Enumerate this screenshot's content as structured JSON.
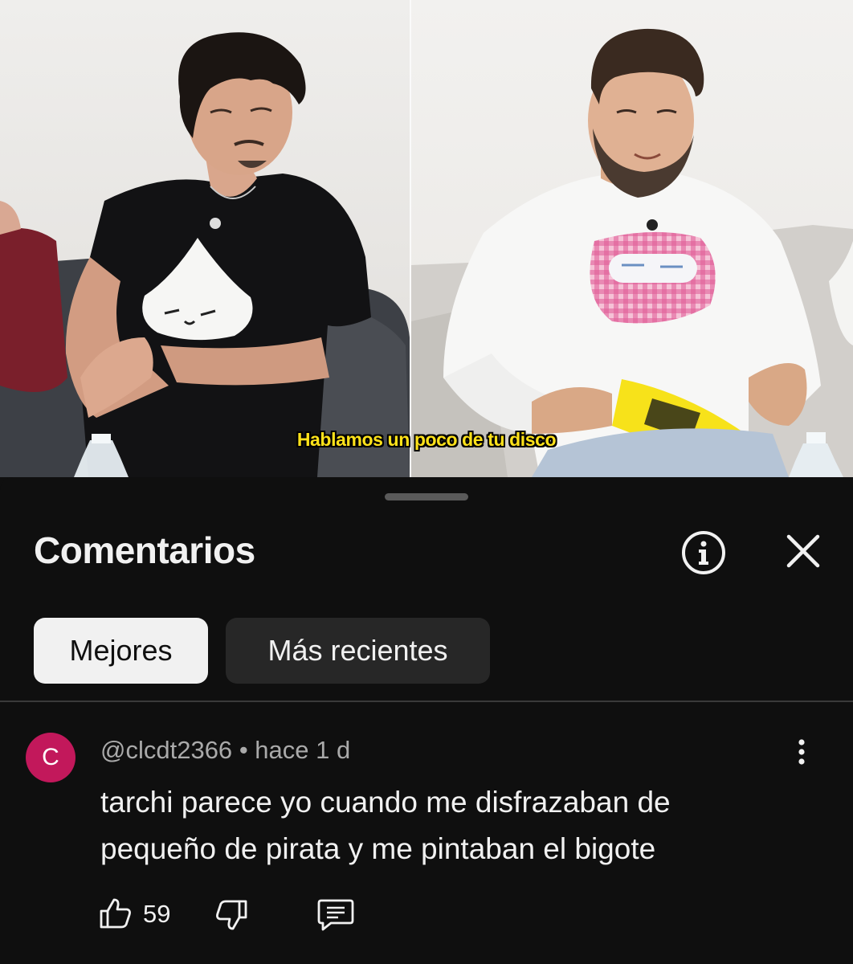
{
  "video": {
    "subtitle": "Hablamos un poco de tu disco"
  },
  "comments_panel": {
    "title": "Comentarios",
    "info_icon": "info-circle-icon",
    "close_icon": "close-icon",
    "sort_chips": [
      {
        "label": "Mejores",
        "selected": true
      },
      {
        "label": "Más recientes",
        "selected": false
      }
    ]
  },
  "comment": {
    "avatar_letter": "C",
    "avatar_color": "#c2185b",
    "author": "@clcdt2366",
    "separator": "•",
    "time": "hace 1 d",
    "text_line_1": "tarchi parece yo cuando me disfrazaban de",
    "text_line_2": "pequeño de pirata y me pintaban el bigote",
    "likes": "59"
  },
  "colors": {
    "background": "#0f0f0f",
    "text_primary": "#f1f1f1",
    "text_secondary": "#aaaaaa",
    "chip_selected_bg": "#f1f1f1",
    "chip_unselected_bg": "#272727",
    "subtitle": "#ffe21a"
  }
}
